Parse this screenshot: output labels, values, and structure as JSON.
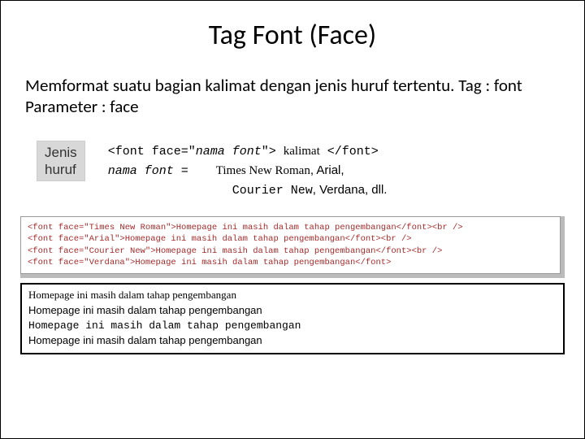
{
  "title": "Tag Font (Face)",
  "description": "Memformat suatu bagian kalimat dengan jenis huruf tertentu. Tag : font Parameter : face",
  "label_box": {
    "line1": "Jenis",
    "line2": "huruf"
  },
  "syntax": {
    "tag_open": "<font face=\"",
    "param": "nama font",
    "tag_mid": "\"> ",
    "kalimat": "kalimat",
    "tag_close": " </font>",
    "eq_left": "nama font",
    "eq_sign": "  =",
    "font1": "Times New Roman",
    "font2_pre": ", ",
    "font2": "Arial,",
    "font3": "Courier New",
    "font4_pre": ", ",
    "font4": "Verdana, dll."
  },
  "code": {
    "l1": "<font face=\"Times New Roman\">Homepage ini masih dalam tahap pengembangan</font><br />",
    "l2": "<font face=\"Arial\">Homepage ini masih dalam tahap pengembangan</font><br />",
    "l3": "<font face=\"Courier New\">Homepage ini masih dalam tahap pengembangan</font><br />",
    "l4": "<font face=\"Verdana\">Homepage ini masih dalam tahap pengembangan</font>"
  },
  "output": {
    "text": "Homepage ini masih dalam tahap pengembangan"
  }
}
